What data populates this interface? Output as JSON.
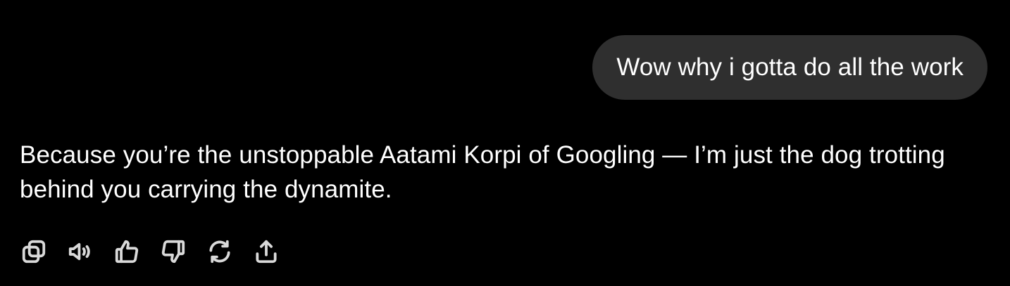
{
  "conversation": {
    "user_message": "Wow why i gotta do all the work",
    "assistant_message": "Because you’re the unstoppable Aatami Korpi of Googling — I’m just the dog trotting behind you carrying the dynamite."
  },
  "action_bar": {
    "icons": [
      "copy-icon",
      "read-aloud-icon",
      "thumbs-up-icon",
      "thumbs-down-icon",
      "regenerate-icon",
      "share-icon"
    ]
  },
  "colors": {
    "background": "#000000",
    "user_bubble": "#2f2f2f",
    "text": "#ffffff",
    "icon": "#d9d9d9"
  }
}
